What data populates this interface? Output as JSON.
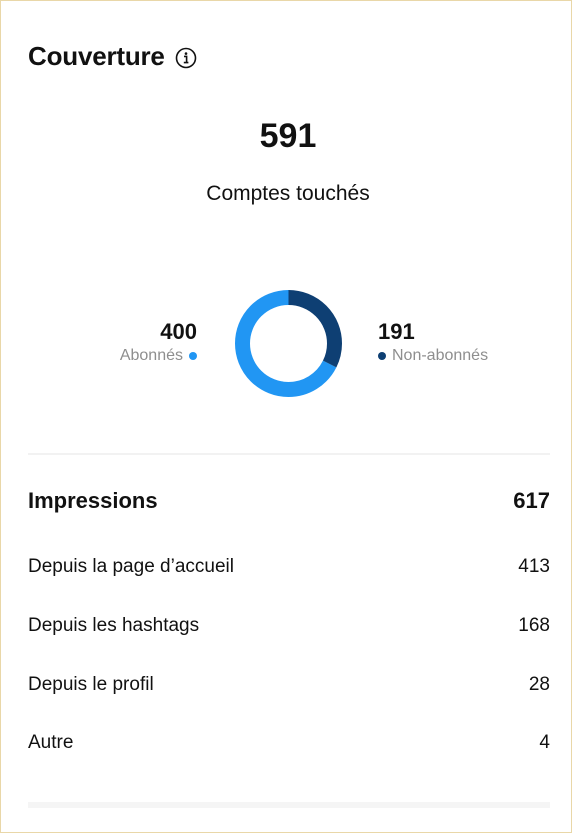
{
  "card": {
    "title": "Couverture",
    "info_icon": "info-circle-icon"
  },
  "reach": {
    "total": "591",
    "total_label": "Comptes touchés",
    "followers": {
      "value": "400",
      "label": "Abonnés",
      "color": "#2196f3"
    },
    "non_followers": {
      "value": "191",
      "label": "Non-abonnés",
      "color": "#0e3f73"
    },
    "donut_fractions": {
      "followers": 0.6768,
      "non_followers": 0.3232
    }
  },
  "impressions": {
    "label": "Impressions",
    "total": "617",
    "rows": [
      {
        "label": "Depuis la page d’accueil",
        "value": "413"
      },
      {
        "label": "Depuis les hashtags",
        "value": "168"
      },
      {
        "label": "Depuis le profil",
        "value": "28"
      },
      {
        "label": "Autre",
        "value": "4"
      }
    ]
  }
}
